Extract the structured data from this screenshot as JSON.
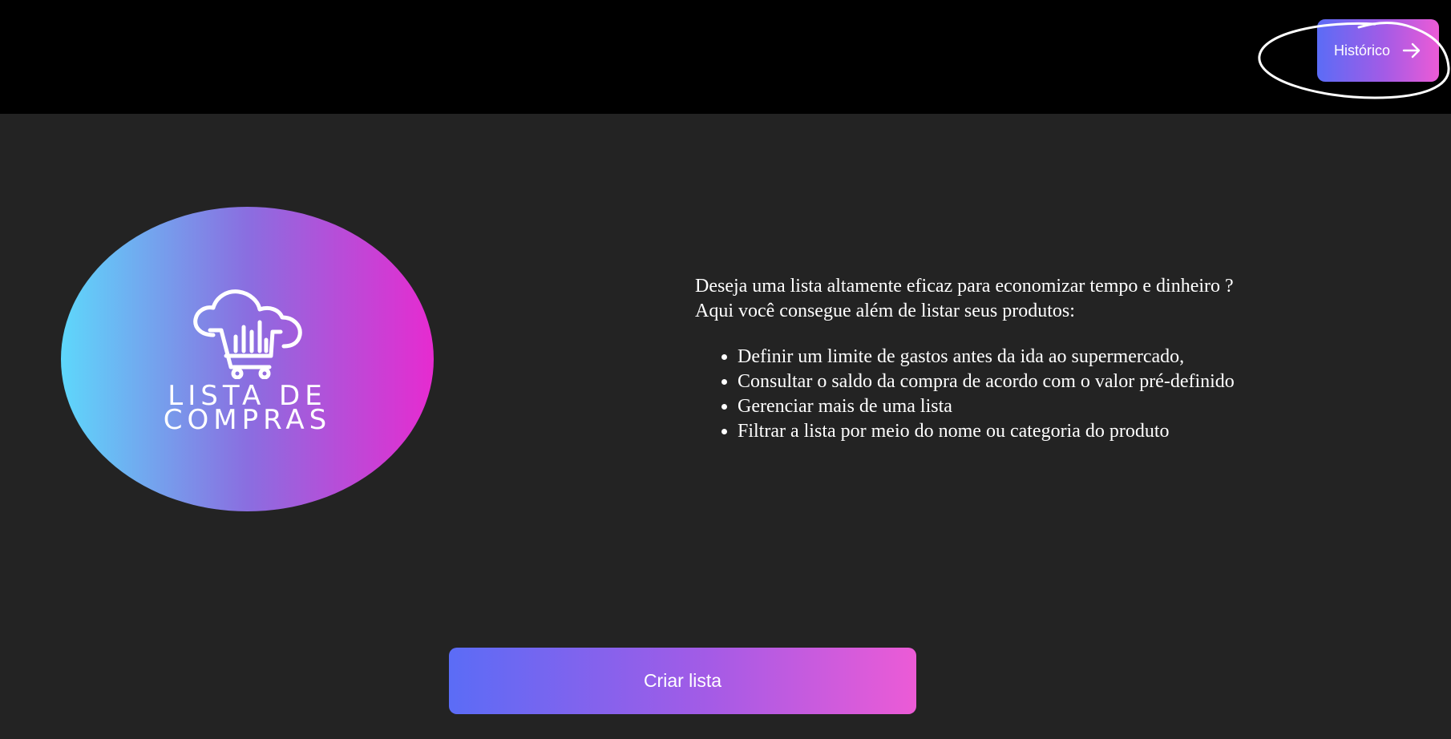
{
  "header": {
    "history_label": "Histórico",
    "history_icon": "arrow-right-icon"
  },
  "logo": {
    "line1": "LISTA DE",
    "line2": "COMPRAS",
    "icon": "cloud-cart-icon"
  },
  "intro": {
    "line1": "Deseja uma lista altamente eficaz para economizar tempo e dinheiro ?",
    "line2": "Aqui você consegue além de listar seus produtos:",
    "features": [
      "Definir um limite de gastos antes da ida ao supermercado,",
      "Consultar o saldo da compra de acordo com o valor pré-definido",
      "Gerenciar mais de uma lista",
      "Filtrar a lista por meio do nome ou categoria do produto"
    ]
  },
  "actions": {
    "create_label": "Criar lista"
  },
  "colors": {
    "header_bg": "#000000",
    "page_bg": "#232323",
    "gradient_start": "#5b6cf6",
    "gradient_end": "#ec5bd6",
    "logo_gradient_start": "#5ed7fb",
    "logo_gradient_end": "#e62bd0"
  }
}
